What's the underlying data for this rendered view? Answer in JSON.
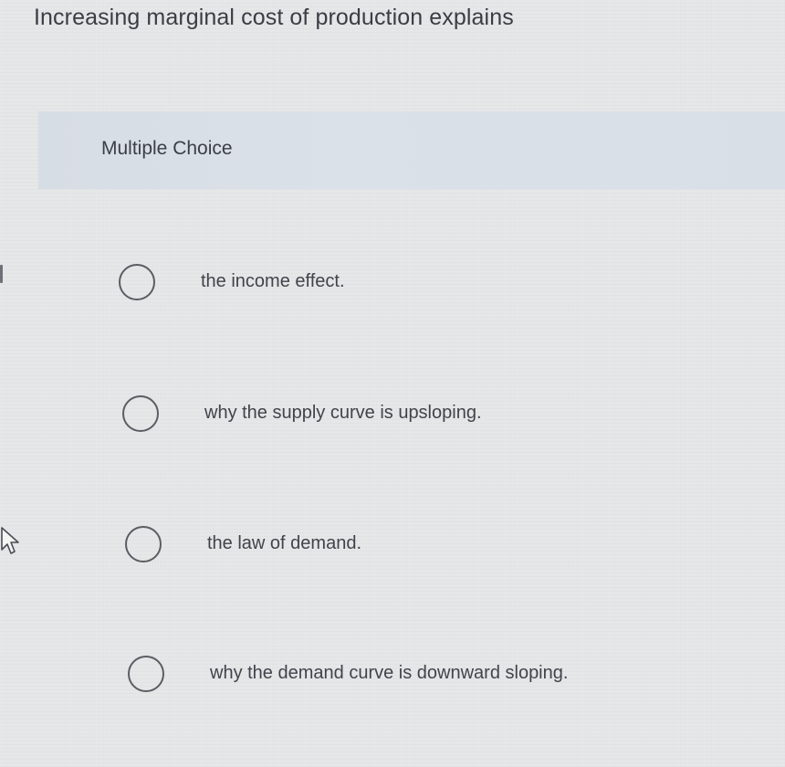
{
  "question": {
    "text": "Increasing marginal cost of production explains"
  },
  "answer_area": {
    "type_label": "Multiple Choice",
    "choices": [
      {
        "label": "the income effect.",
        "selected": false
      },
      {
        "label": "why the supply curve is upsloping.",
        "selected": false
      },
      {
        "label": "the law of demand.",
        "selected": false
      },
      {
        "label": "why the demand curve is downward sloping.",
        "selected": false
      }
    ]
  },
  "icons": {
    "cursor": "mouse-pointer-icon",
    "radio": "radio-unselected-icon"
  }
}
